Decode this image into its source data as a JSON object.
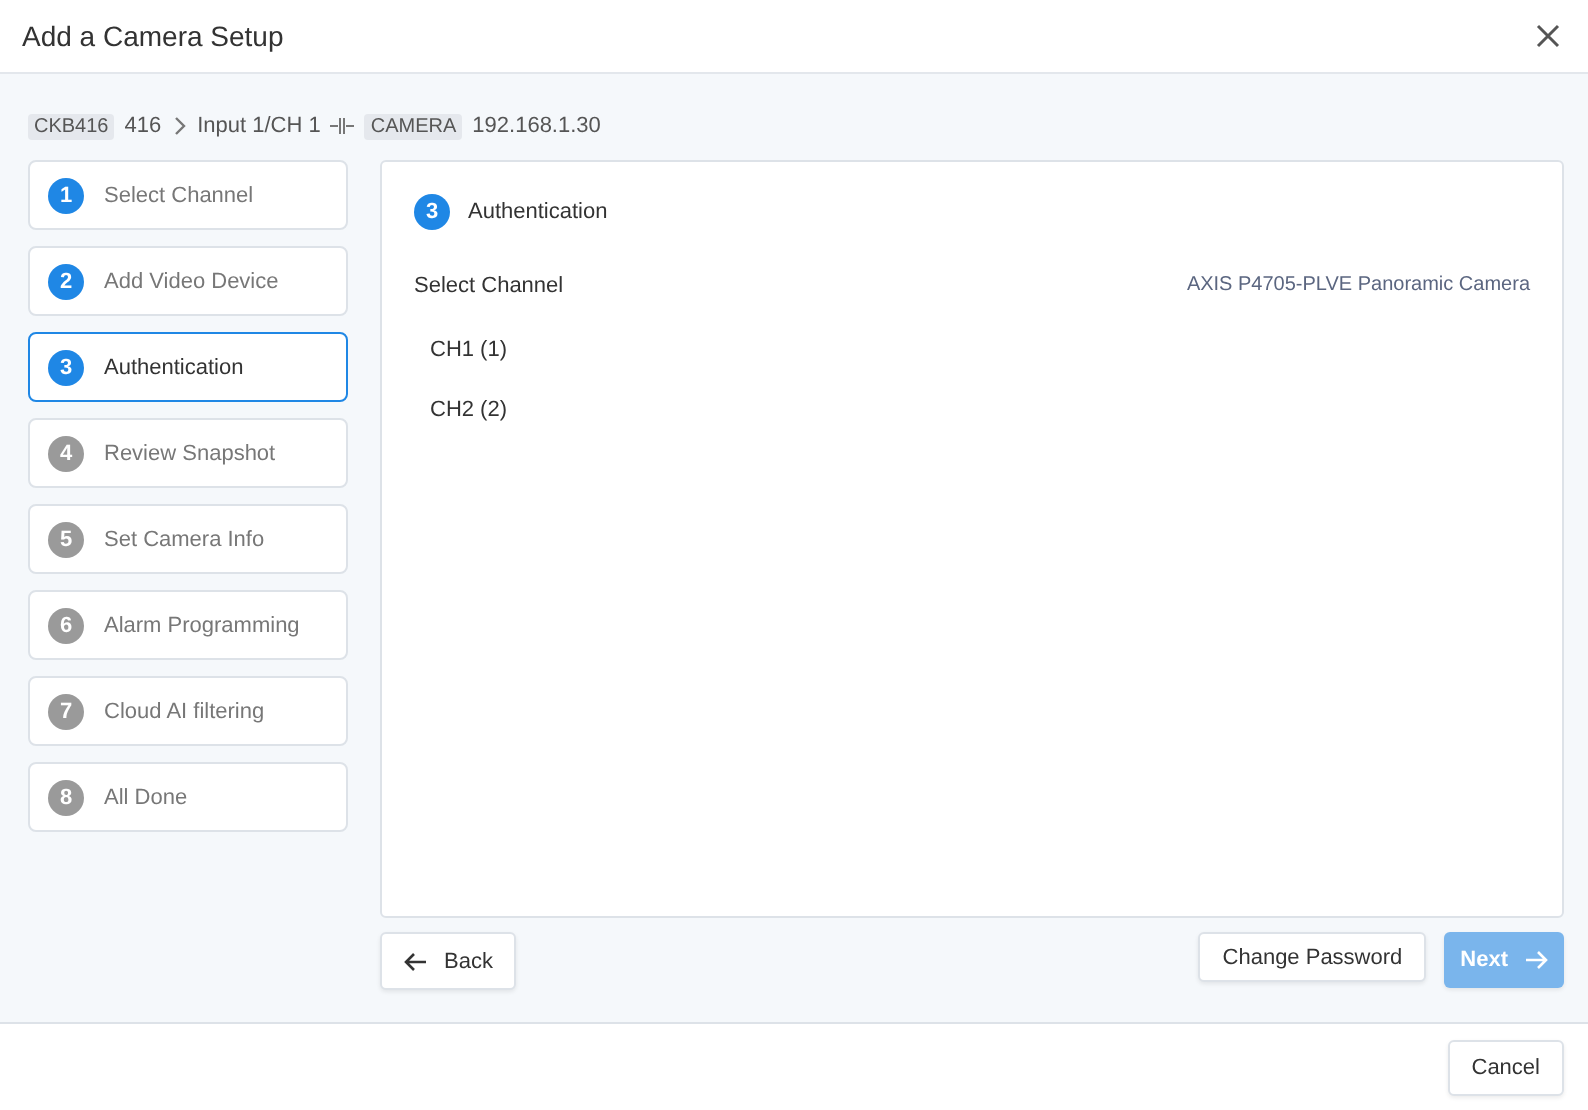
{
  "window": {
    "title": "Add a Camera Setup"
  },
  "breadcrumb": {
    "device_tag": "CKB416",
    "device": "416",
    "input": "Input 1/CH 1",
    "camera_tag": "CAMERA",
    "camera_ip": "192.168.1.30"
  },
  "steps": [
    {
      "number": "1",
      "label": "Select Channel",
      "selected": false,
      "completed": true
    },
    {
      "number": "2",
      "label": "Add Video Device",
      "selected": false,
      "completed": true
    },
    {
      "number": "3",
      "label": "Authentication",
      "selected": true,
      "completed": true
    },
    {
      "number": "4",
      "label": "Review Snapshot",
      "selected": false,
      "completed": false
    },
    {
      "number": "5",
      "label": "Set Camera Info",
      "selected": false,
      "completed": false
    },
    {
      "number": "6",
      "label": "Alarm Programming",
      "selected": false,
      "completed": false
    },
    {
      "number": "7",
      "label": "Cloud AI filtering",
      "selected": false,
      "completed": false
    },
    {
      "number": "8",
      "label": "All Done",
      "selected": false,
      "completed": false
    }
  ],
  "panel": {
    "step_number": "3",
    "title": "Authentication",
    "section_label": "Select Channel",
    "camera_model": "AXIS P4705-PLVE Panoramic Camera",
    "channels": [
      "CH1 (1)",
      "CH2 (2)"
    ]
  },
  "buttons": {
    "back": "Back",
    "change_password": "Change Password",
    "next": {
      "label": "Next",
      "disabled": true
    },
    "cancel": "Cancel"
  }
}
